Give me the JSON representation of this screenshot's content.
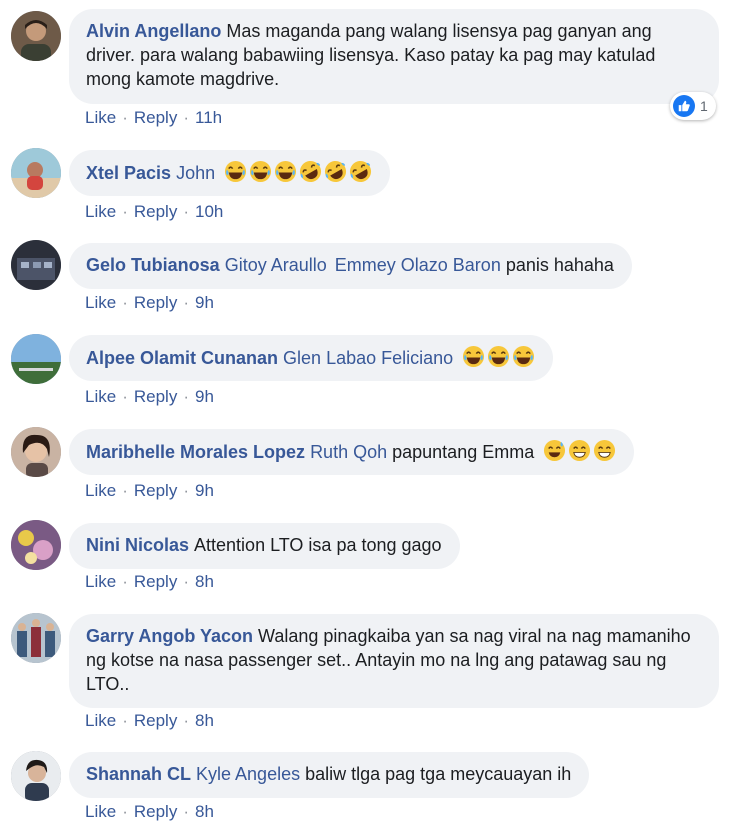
{
  "action_labels": {
    "like": "Like",
    "reply": "Reply",
    "separator": "·"
  },
  "colors": {
    "link": "#385898",
    "bubble": "#f0f2f5",
    "like_blue": "#1877f2",
    "text": "#1c1e21"
  },
  "comments": [
    {
      "author": "Alvin Angellano",
      "mentions": [],
      "text": "Mas maganda pang walang lisensya pag ganyan ang driver. para walang babawiing lisensya. Kaso patay ka pag may katulad mong kamote magdrive.",
      "emojis": [],
      "time": "11h",
      "reaction": {
        "icon": "like-icon",
        "count": "1"
      }
    },
    {
      "author": "Xtel Pacis",
      "mentions": [
        "John"
      ],
      "text": "",
      "emojis": [
        "joy-emoji",
        "joy-emoji",
        "joy-emoji",
        "rofl-emoji",
        "rofl-emoji",
        "rofl-emoji"
      ],
      "time": "10h"
    },
    {
      "author": "Gelo Tubianosa",
      "mentions": [
        "Gitoy Araullo",
        "Emmey Olazo Baron"
      ],
      "text": "panis hahaha",
      "emojis": [],
      "time": "9h"
    },
    {
      "author": "Alpee Olamit Cunanan",
      "mentions": [
        "Glen Labao Feliciano"
      ],
      "text": "",
      "emojis": [
        "joy-emoji",
        "joy-emoji",
        "joy-emoji"
      ],
      "time": "9h"
    },
    {
      "author": "Maribhelle Morales Lopez",
      "mentions": [
        "Ruth Qoh"
      ],
      "text": "papuntang Emma",
      "emojis": [
        "sweat-smile-emoji",
        "grin-emoji",
        "grin-emoji"
      ],
      "time": "9h"
    },
    {
      "author": "Nini Nicolas",
      "mentions": [],
      "text": "Attention LTO isa pa tong gago",
      "emojis": [],
      "time": "8h"
    },
    {
      "author": "Garry Angob Yacon",
      "mentions": [],
      "text": "Walang pinagkaiba yan sa nag viral na nag mamaniho ng kotse na nasa passenger set.. Antayin mo na lng ang patawag sau ng LTO..",
      "emojis": [],
      "time": "8h"
    },
    {
      "author": "Shannah CL",
      "mentions": [
        "Kyle Angeles"
      ],
      "text": "baliw tlga pag tga meycauayan ih",
      "emojis": [],
      "time": "8h"
    }
  ]
}
